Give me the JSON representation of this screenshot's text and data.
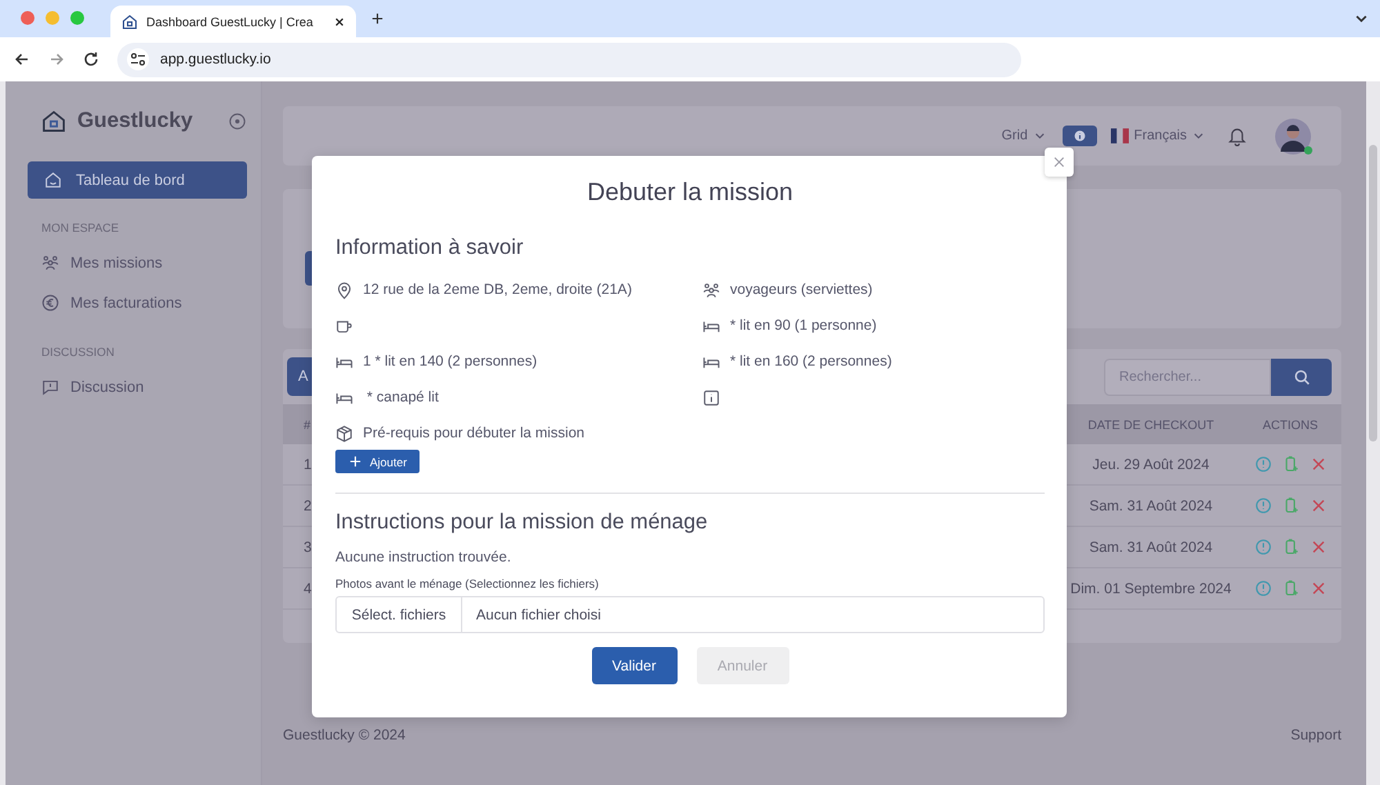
{
  "browser": {
    "tab_title": "Dashboard GuestLucky | Crea",
    "url": "app.guestlucky.io"
  },
  "sidebar": {
    "brand": "Guestlucky",
    "home": {
      "label": "Tableau de bord",
      "selected": true
    },
    "sections": [
      {
        "title": "MON ESPACE",
        "items": [
          {
            "label": "Mes missions",
            "kind": "people",
            "selected": false
          },
          {
            "label": "Mes facturations",
            "kind": "euro",
            "selected": false
          }
        ]
      },
      {
        "title": "DISCUSSION",
        "items": [
          {
            "label": "Discussion",
            "kind": "chat",
            "selected": false
          }
        ]
      }
    ]
  },
  "header": {
    "view": "Grid",
    "language": "Français"
  },
  "missions_card": {
    "button_fragment": "A",
    "search": {
      "placeholder": "Rechercher..."
    },
    "table": {
      "columns": [
        {
          "label": "#",
          "kind": "index"
        },
        {
          "label": "DATE DE CHECKOUT",
          "kind": "date"
        },
        {
          "label": "ACTIONS",
          "kind": "actions"
        }
      ],
      "rows": [
        {
          "index": "1",
          "checkout": "Jeu. 29 Août 2024"
        },
        {
          "index": "2",
          "checkout": "Sam. 31 Août 2024"
        },
        {
          "index": "3",
          "checkout": "Sam. 31 Août 2024"
        },
        {
          "index": "4",
          "checkout": "Dim. 01 Septembre 2024"
        }
      ]
    }
  },
  "footer": {
    "copyright": "Guestlucky © 2024",
    "link": "Support"
  },
  "modal": {
    "title": "Debuter la mission",
    "info_heading": "Information à savoir",
    "info": [
      {
        "kind": "pin",
        "text": "12 rue de la 2eme DB, 2eme, droite (21A)"
      },
      {
        "kind": "people",
        "text": "voyageurs (serviettes)"
      },
      {
        "kind": "cup"
      },
      {
        "kind": "bed",
        "text": "* lit en 90 (1 personne)"
      },
      {
        "kind": "bed",
        "text": "1 * lit en 140 (2 personnes)"
      },
      {
        "kind": "bed",
        "text": "* lit en 160 (2 personnes)"
      },
      {
        "kind": "bed",
        "text": " * canapé lit"
      },
      {
        "kind": "info"
      },
      {
        "kind": "box",
        "text": "Pré-requis pour débuter la mission"
      }
    ],
    "add_button": "Ajouter",
    "instructions_heading": "Instructions pour la mission de ménage",
    "instructions_note": "Aucune instruction trouvée.",
    "photos_label": "Photos avant le ménage (Selectionnez les fichiers)",
    "file_button": "Sélect. fichiers",
    "file_status": "Aucun fichier choisi",
    "buttons": [
      {
        "label": "Valider",
        "kind": "primary",
        "disabled": false
      },
      {
        "label": "Annuler",
        "kind": "secondary",
        "disabled": true
      }
    ]
  }
}
